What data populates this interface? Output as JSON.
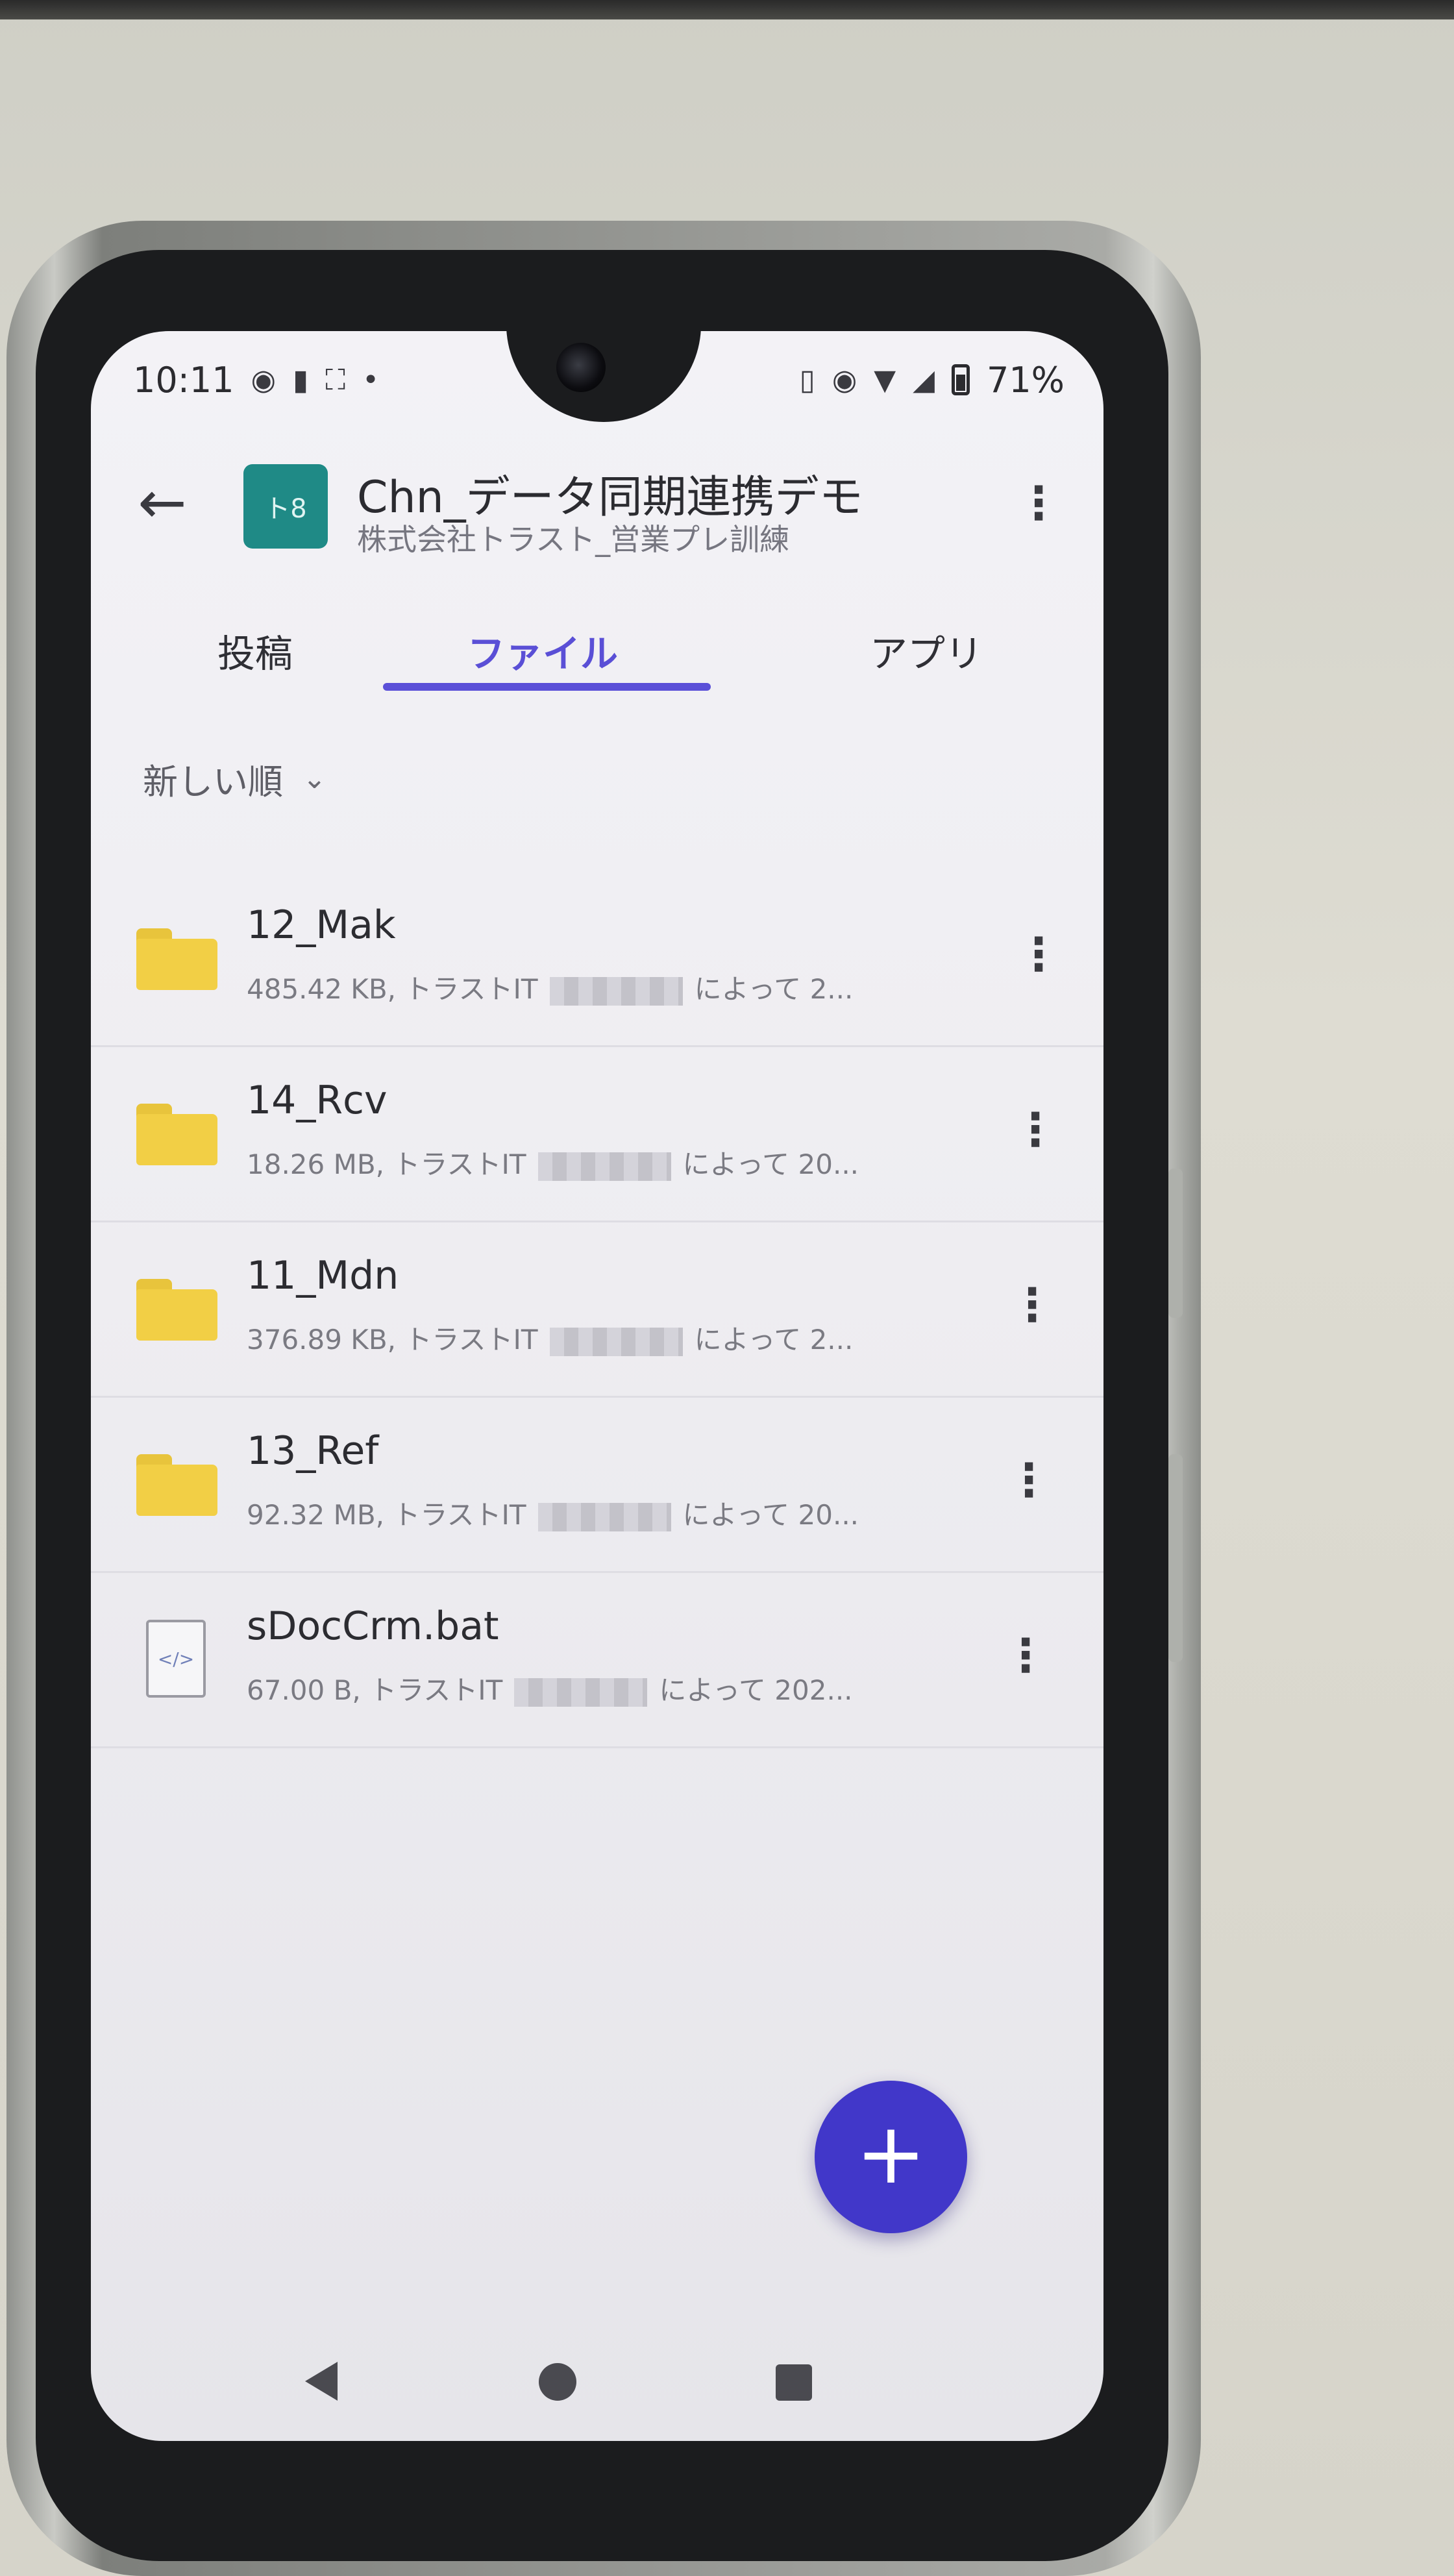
{
  "status_bar": {
    "time": "10:11",
    "battery": "71%",
    "left_icons": [
      "notification-dot-icon",
      "sim-icon",
      "vpn-icon",
      "more-dot-icon"
    ],
    "right_icons": [
      "vibrate-icon",
      "eye-icon",
      "wifi-icon",
      "signal-icon",
      "battery-icon"
    ]
  },
  "header": {
    "avatar_text": "ト8",
    "title": "Chn_データ同期連携デモ",
    "subtitle": "株式会社トラスト_営業プレ訓練"
  },
  "tabs": [
    {
      "label": "投稿",
      "active": false
    },
    {
      "label": "ファイル",
      "active": true
    },
    {
      "label": "アプリ",
      "active": false
    }
  ],
  "sort": {
    "label": "新しい順"
  },
  "items": [
    {
      "name": "12_Mak",
      "type": "folder",
      "size": "485.42 KB, トラストIT",
      "by": "によって 2..."
    },
    {
      "name": "14_Rcv",
      "type": "folder",
      "size": "18.26 MB, トラストIT",
      "by": "によって 20..."
    },
    {
      "name": "11_Mdn",
      "type": "folder",
      "size": "376.89 KB, トラストIT",
      "by": "によって 2..."
    },
    {
      "name": "13_Ref",
      "type": "folder",
      "size": "92.32 MB, トラストIT",
      "by": "によって 20..."
    },
    {
      "name": "sDocCrm.bat",
      "type": "file",
      "size": "67.00 B, トラストIT",
      "by": "によって 202..."
    }
  ],
  "fab": {
    "label": "+"
  },
  "colors": {
    "accent": "#5b50d8",
    "fab": "#4137c9",
    "folder": "#f2cf45",
    "team_avatar": "#1f8a86"
  }
}
